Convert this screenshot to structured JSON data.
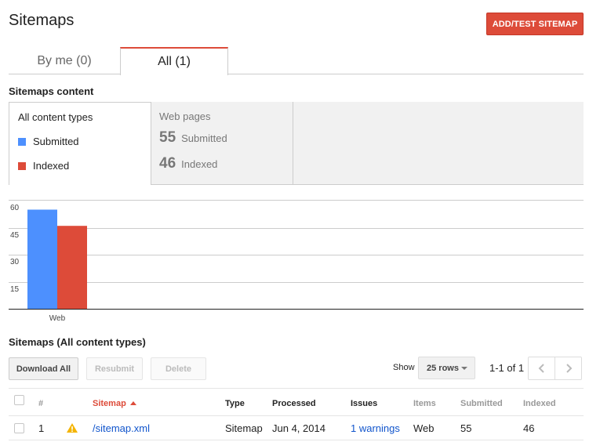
{
  "header": {
    "title": "Sitemaps",
    "add_button": "ADD/TEST SITEMAP"
  },
  "tabs": [
    {
      "label": "By me (0)",
      "active": false
    },
    {
      "label": "All (1)",
      "active": true
    }
  ],
  "content_section": {
    "label": "Sitemaps content",
    "all_types": "All content types",
    "legend": [
      {
        "label": "Submitted",
        "color": "#4d90fe"
      },
      {
        "label": "Indexed",
        "color": "#dd4b39"
      }
    ],
    "web_pages": {
      "title": "Web pages",
      "submitted_count": "55",
      "submitted_label": "Submitted",
      "indexed_count": "46",
      "indexed_label": "Indexed"
    }
  },
  "chart_data": {
    "type": "bar",
    "categories": [
      "Web"
    ],
    "series": [
      {
        "name": "Submitted",
        "values": [
          55
        ],
        "color": "#4d90fe"
      },
      {
        "name": "Indexed",
        "values": [
          46
        ],
        "color": "#dd4b39"
      }
    ],
    "yticks": [
      15,
      30,
      45,
      60
    ],
    "ylim": [
      0,
      60
    ],
    "grid": true
  },
  "table_section": {
    "label": "Sitemaps (All content types)",
    "download_button": "Download All",
    "resubmit_button": "Resubmit",
    "delete_button": "Delete",
    "show_label": "Show",
    "rows_select": "25 rows",
    "range": "1-1 of 1",
    "columns": [
      "#",
      "Sitemap",
      "Type",
      "Processed",
      "Issues",
      "Items",
      "Submitted",
      "Indexed"
    ],
    "rows": [
      {
        "num": "1",
        "sitemap": "/sitemap.xml",
        "type": "Sitemap",
        "processed": "Jun 4, 2014",
        "issues": "1 warnings",
        "items": "Web",
        "submitted": "55",
        "indexed": "46"
      }
    ]
  }
}
